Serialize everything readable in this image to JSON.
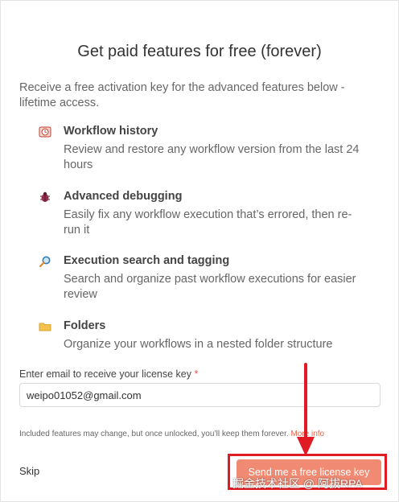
{
  "dialog": {
    "title": "Get paid features for free (forever)",
    "intro": "Receive a free activation key for the advanced features below - lifetime access."
  },
  "features": [
    {
      "icon": "clock-icon",
      "glyph": "⏲",
      "color": "#c0392b",
      "title": "Workflow history",
      "description": "Review and restore any workflow version from the last 24 hours"
    },
    {
      "icon": "bug-icon",
      "glyph": "🐞",
      "color": "#8e2c4a",
      "title": "Advanced debugging",
      "description": "Easily fix any workflow execution that’s errored, then re-run it"
    },
    {
      "icon": "magnifier-icon",
      "glyph": "🔎",
      "color": "#2c7fb8",
      "title": "Execution search and tagging",
      "description": "Search and organize past workflow executions for easier review"
    },
    {
      "icon": "folder-icon",
      "glyph": "📁",
      "color": "#f2c14e",
      "title": "Folders",
      "description": "Organize your workflows in a nested folder structure"
    }
  ],
  "email": {
    "label": "Enter email to receive your license key",
    "required_mark": "*",
    "value": "weipo01052@gmail.com"
  },
  "footnote": {
    "text": "Included features may change, but once unlocked, you’ll keep them forever.",
    "link": "More info"
  },
  "actions": {
    "skip": "Skip",
    "send": "Send me a free license key"
  },
  "overlay": {
    "watermark": "掘金技术社区 @ 阿拔RPA",
    "highlight_color": "#e01b24"
  }
}
